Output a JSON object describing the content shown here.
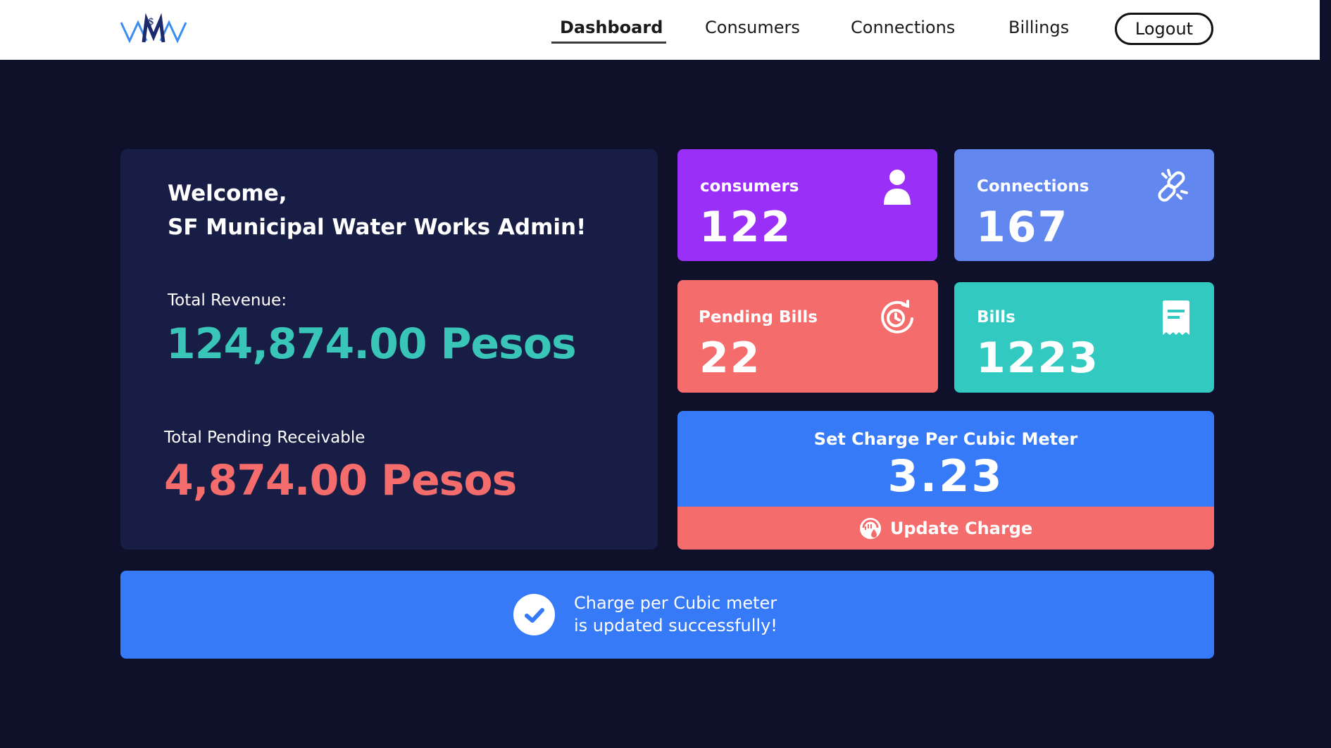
{
  "nav": {
    "items": [
      {
        "label": "Dashboard",
        "active": true
      },
      {
        "label": "Consumers",
        "active": false
      },
      {
        "label": "Connections",
        "active": false
      },
      {
        "label": "Billings",
        "active": false
      }
    ],
    "logout_label": "Logout"
  },
  "welcome": {
    "line1": "Welcome,",
    "line2": "SF Municipal Water Works Admin!",
    "revenue_label": "Total Revenue:",
    "revenue_value": "124,874.00 Pesos",
    "pending_label": "Total Pending Receivable",
    "pending_value": "4,874.00 Pesos"
  },
  "cards": [
    {
      "label": "consumers",
      "value": "122",
      "icon": "user-icon",
      "color": "#9a30f7"
    },
    {
      "label": "Connections",
      "value": "167",
      "icon": "broken-link-icon",
      "color": "#6287ef"
    },
    {
      "label": "Pending Bills",
      "value": "22",
      "icon": "clock-refresh-icon",
      "color": "#f46c6c"
    },
    {
      "label": "Bills",
      "value": "1223",
      "icon": "receipt-icon",
      "color": "#31c9c0"
    }
  ],
  "charge": {
    "label": "Set Charge Per Cubic Meter",
    "value": "3.23",
    "button_label": "Update Charge"
  },
  "toast": {
    "line1": "Charge per Cubic meter",
    "line2": "is updated successfully!"
  },
  "colors": {
    "background": "#0e1129",
    "panel": "#171d45",
    "revenue": "#39c5b8",
    "pending": "#f46c6c",
    "primary_blue": "#367af7",
    "logo_navy": "#1c2a6b",
    "logo_blue": "#3b8ef0"
  }
}
